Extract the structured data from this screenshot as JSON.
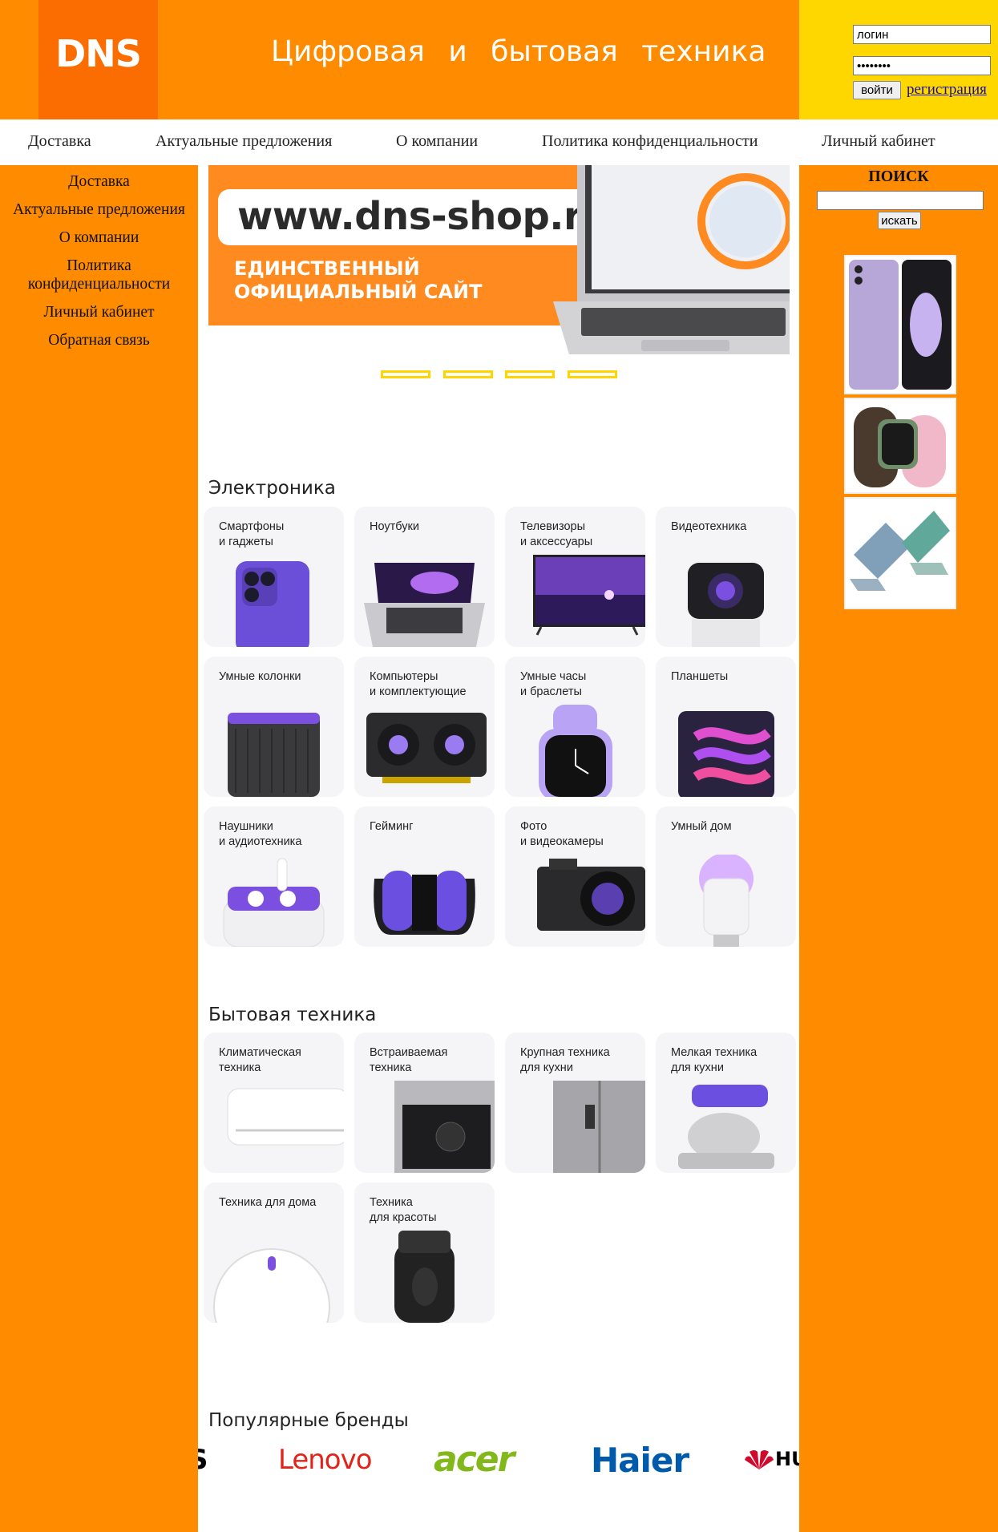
{
  "header": {
    "logo": "DNS",
    "tagline": "Цифровая и бытовая техника",
    "login_value": "логин",
    "password_value": "••••••••",
    "login_button": "войти",
    "register_link": "регистрация"
  },
  "top_nav": [
    "Доставка",
    "Актуальные предложения",
    "О компании",
    "Политика конфиденциальности",
    "Личный кабинет"
  ],
  "left_menu": [
    "Доставка",
    "Актуальные предложения",
    "О компании",
    "Политика конфиденциальности",
    "Личный кабинет",
    "Обратная связь"
  ],
  "search": {
    "title": "поиск",
    "button": "искать",
    "value": ""
  },
  "banner": {
    "url": "www.dns-shop.ru",
    "caption_line1": "ЕДИНСТВЕННЫЙ",
    "caption_line2": "ОФИЦИАЛЬНЫЙ САЙТ",
    "slides": 4
  },
  "sections": {
    "electronics": {
      "title": "Электроника",
      "tiles": [
        {
          "label": "Смартфоны\nи гаджеты",
          "icon": "smartphone"
        },
        {
          "label": "Ноутбуки",
          "icon": "laptop"
        },
        {
          "label": "Телевизоры\nи аксессуары",
          "icon": "tv"
        },
        {
          "label": "Видеотехника",
          "icon": "projector"
        },
        {
          "label": "Умные колонки",
          "icon": "smart-speaker"
        },
        {
          "label": "Компьютеры\nи комплектующие",
          "icon": "graphics-card"
        },
        {
          "label": "Умные часы\nи браслеты",
          "icon": "smartwatch"
        },
        {
          "label": "Планшеты",
          "icon": "tablet"
        },
        {
          "label": "Наушники\nи аудиотехника",
          "icon": "earbuds"
        },
        {
          "label": "Гейминг",
          "icon": "gamepad"
        },
        {
          "label": "Фото\nи видеокамеры",
          "icon": "camera"
        },
        {
          "label": "Умный дом",
          "icon": "smart-bulb"
        }
      ]
    },
    "appliances": {
      "title": "Бытовая техника",
      "tiles": [
        {
          "label": "Климатическая\nтехника",
          "icon": "air-conditioner"
        },
        {
          "label": "Встраиваемая\nтехника",
          "icon": "oven"
        },
        {
          "label": "Крупная техника\nдля кухни",
          "icon": "fridge"
        },
        {
          "label": "Мелкая техника\nдля кухни",
          "icon": "mixer"
        },
        {
          "label": "Техника для дома",
          "icon": "robot-vacuum"
        },
        {
          "label": "Техника\nдля красоты",
          "icon": "shaver"
        }
      ]
    },
    "brands": {
      "title": "Популярные бренды",
      "items": [
        {
          "name": "ASUS",
          "shown": "S",
          "color": "#000000"
        },
        {
          "name": "Lenovo",
          "shown": "Lenovo",
          "color": "#e2231a"
        },
        {
          "name": "acer",
          "shown": "acer",
          "color": "#83b81a"
        },
        {
          "name": "Haier",
          "shown": "Haier",
          "color": "#005aab"
        },
        {
          "name": "HUAWEI",
          "shown": "HU",
          "color": "#000000"
        }
      ]
    }
  },
  "colors": {
    "orange": "#ff8c00",
    "logo_orange": "#fc6d01",
    "yellow": "#ffd700",
    "tile_bg": "#f5f5f7",
    "accent_purple": "#7b4fe0"
  }
}
